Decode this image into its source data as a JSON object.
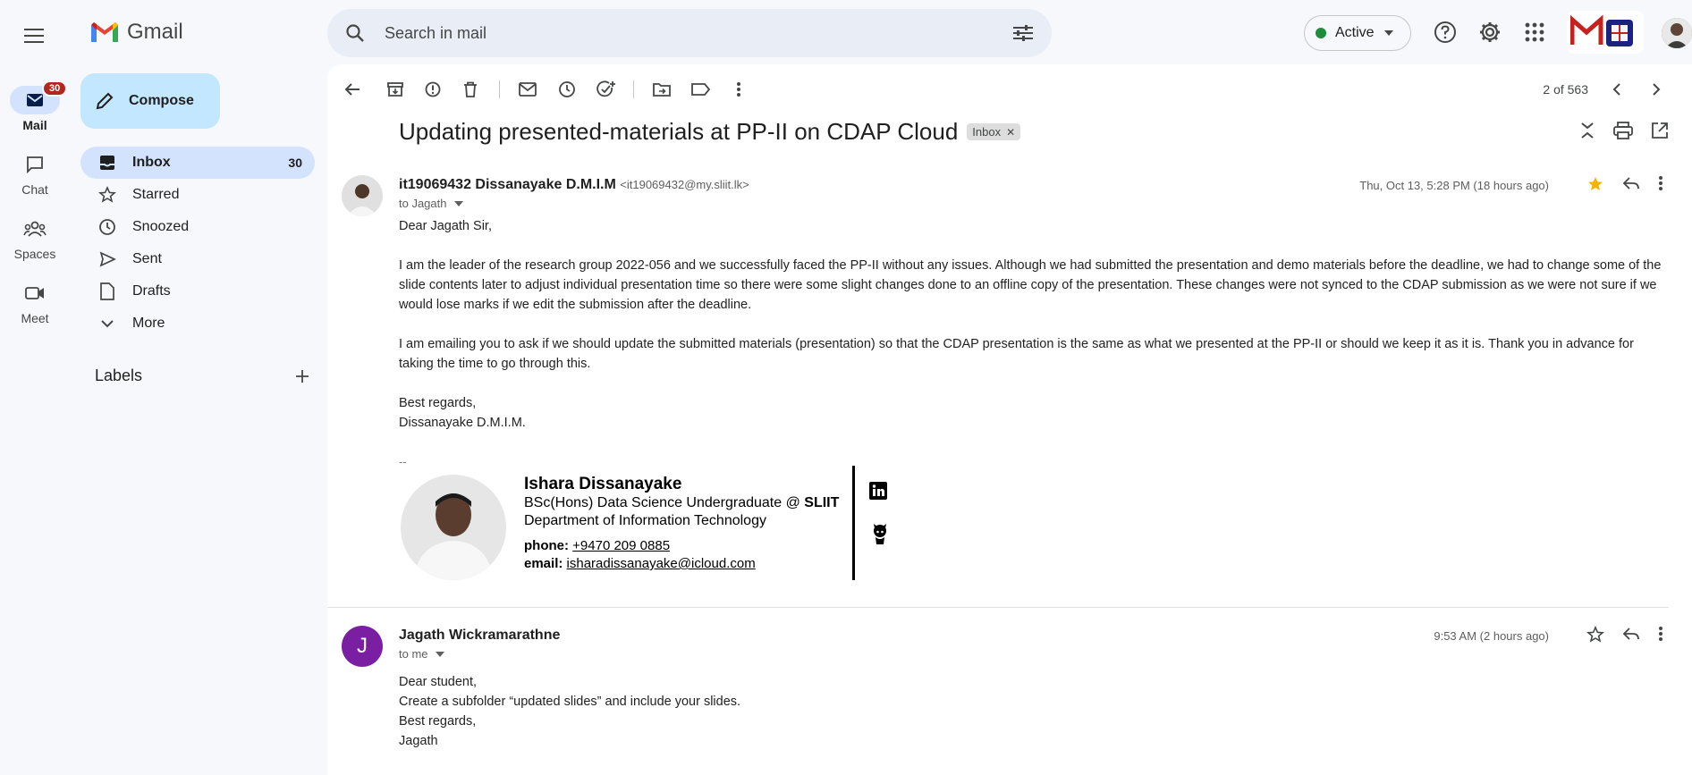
{
  "app": {
    "name": "Gmail"
  },
  "rail": {
    "items": [
      {
        "label": "Mail",
        "badge": "30"
      },
      {
        "label": "Chat"
      },
      {
        "label": "Spaces"
      },
      {
        "label": "Meet"
      }
    ]
  },
  "compose": {
    "label": "Compose"
  },
  "nav": {
    "items": [
      {
        "label": "Inbox",
        "count": "30"
      },
      {
        "label": "Starred"
      },
      {
        "label": "Snoozed"
      },
      {
        "label": "Sent"
      },
      {
        "label": "Drafts"
      },
      {
        "label": "More"
      }
    ],
    "labels_heading": "Labels"
  },
  "search": {
    "placeholder": "Search in mail"
  },
  "status": {
    "label": "Active"
  },
  "toolbar": {
    "pager": "2 of 563"
  },
  "thread": {
    "subject": "Updating presented-materials at PP-II on CDAP Cloud",
    "tag": "Inbox"
  },
  "message1": {
    "sender_name": "it19069432 Dissanayake D.M.I.M",
    "sender_email": "<it19069432@my.sliit.lk>",
    "to": "to Jagath",
    "date": "Thu, Oct 13, 5:28 PM (18 hours ago)",
    "greeting": "Dear Jagath Sir,",
    "para1": "I am the leader of the research group 2022-056 and we successfully faced the PP-II without any issues. Although we had submitted the presentation and demo materials before the deadline, we had to change some of the slide contents later to adjust individual presentation time so there were some slight changes done to an offline copy of the presentation. These changes were not synced to the CDAP submission as we were not sure if we would lose marks if we edit the submission after the deadline.",
    "para2": "I am emailing you to ask if we should update the submitted materials (presentation) so that the CDAP presentation is the same as what we presented at the PP-II or should we keep it as it is. Thank you in advance for taking the time to go through this.",
    "closing": "Best regards,",
    "signoff": "Dissanayake D.M.I.M.",
    "dashes": "--"
  },
  "signature": {
    "name": "Ishara Dissanayake",
    "line1_prefix": "BSc(Hons) Data Science Undergraduate @ ",
    "line1_org": "SLIIT",
    "line2": "Department of Information Technology",
    "phone_label": "phone:",
    "phone": "+9470 209 0885",
    "email_label": "email:",
    "email": "isharadissanayake@icloud.com"
  },
  "message2": {
    "avatar_letter": "J",
    "sender_name": "Jagath Wickramarathne",
    "to": "to me",
    "date": "9:53 AM (2 hours ago)",
    "line1": "Dear student,",
    "line2": "Create a subfolder “updated slides” and include your slides.",
    "line3": "Best regards,",
    "line4": "Jagath"
  }
}
